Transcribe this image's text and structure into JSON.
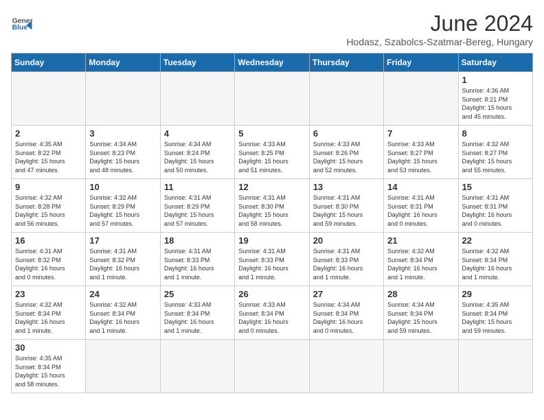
{
  "header": {
    "title": "June 2024",
    "subtitle": "Hodasz, Szabolcs-Szatmar-Bereg, Hungary",
    "logo_general": "General",
    "logo_blue": "Blue"
  },
  "weekdays": [
    "Sunday",
    "Monday",
    "Tuesday",
    "Wednesday",
    "Thursday",
    "Friday",
    "Saturday"
  ],
  "weeks": [
    [
      {
        "day": "",
        "info": ""
      },
      {
        "day": "",
        "info": ""
      },
      {
        "day": "",
        "info": ""
      },
      {
        "day": "",
        "info": ""
      },
      {
        "day": "",
        "info": ""
      },
      {
        "day": "",
        "info": ""
      },
      {
        "day": "1",
        "info": "Sunrise: 4:36 AM\nSunset: 8:21 PM\nDaylight: 15 hours\nand 45 minutes."
      }
    ],
    [
      {
        "day": "2",
        "info": "Sunrise: 4:35 AM\nSunset: 8:22 PM\nDaylight: 15 hours\nand 47 minutes."
      },
      {
        "day": "3",
        "info": "Sunrise: 4:34 AM\nSunset: 8:23 PM\nDaylight: 15 hours\nand 48 minutes."
      },
      {
        "day": "4",
        "info": "Sunrise: 4:34 AM\nSunset: 8:24 PM\nDaylight: 15 hours\nand 50 minutes."
      },
      {
        "day": "5",
        "info": "Sunrise: 4:33 AM\nSunset: 8:25 PM\nDaylight: 15 hours\nand 51 minutes."
      },
      {
        "day": "6",
        "info": "Sunrise: 4:33 AM\nSunset: 8:26 PM\nDaylight: 15 hours\nand 52 minutes."
      },
      {
        "day": "7",
        "info": "Sunrise: 4:33 AM\nSunset: 8:27 PM\nDaylight: 15 hours\nand 53 minutes."
      },
      {
        "day": "8",
        "info": "Sunrise: 4:32 AM\nSunset: 8:27 PM\nDaylight: 15 hours\nand 55 minutes."
      }
    ],
    [
      {
        "day": "9",
        "info": "Sunrise: 4:32 AM\nSunset: 8:28 PM\nDaylight: 15 hours\nand 56 minutes."
      },
      {
        "day": "10",
        "info": "Sunrise: 4:32 AM\nSunset: 8:29 PM\nDaylight: 15 hours\nand 57 minutes."
      },
      {
        "day": "11",
        "info": "Sunrise: 4:31 AM\nSunset: 8:29 PM\nDaylight: 15 hours\nand 57 minutes."
      },
      {
        "day": "12",
        "info": "Sunrise: 4:31 AM\nSunset: 8:30 PM\nDaylight: 15 hours\nand 58 minutes."
      },
      {
        "day": "13",
        "info": "Sunrise: 4:31 AM\nSunset: 8:30 PM\nDaylight: 15 hours\nand 59 minutes."
      },
      {
        "day": "14",
        "info": "Sunrise: 4:31 AM\nSunset: 8:31 PM\nDaylight: 16 hours\nand 0 minutes."
      },
      {
        "day": "15",
        "info": "Sunrise: 4:31 AM\nSunset: 8:31 PM\nDaylight: 16 hours\nand 0 minutes."
      }
    ],
    [
      {
        "day": "16",
        "info": "Sunrise: 4:31 AM\nSunset: 8:32 PM\nDaylight: 16 hours\nand 0 minutes."
      },
      {
        "day": "17",
        "info": "Sunrise: 4:31 AM\nSunset: 8:32 PM\nDaylight: 16 hours\nand 1 minute."
      },
      {
        "day": "18",
        "info": "Sunrise: 4:31 AM\nSunset: 8:33 PM\nDaylight: 16 hours\nand 1 minute."
      },
      {
        "day": "19",
        "info": "Sunrise: 4:31 AM\nSunset: 8:33 PM\nDaylight: 16 hours\nand 1 minute."
      },
      {
        "day": "20",
        "info": "Sunrise: 4:31 AM\nSunset: 8:33 PM\nDaylight: 16 hours\nand 1 minute."
      },
      {
        "day": "21",
        "info": "Sunrise: 4:32 AM\nSunset: 8:34 PM\nDaylight: 16 hours\nand 1 minute."
      },
      {
        "day": "22",
        "info": "Sunrise: 4:32 AM\nSunset: 8:34 PM\nDaylight: 16 hours\nand 1 minute."
      }
    ],
    [
      {
        "day": "23",
        "info": "Sunrise: 4:32 AM\nSunset: 8:34 PM\nDaylight: 16 hours\nand 1 minute."
      },
      {
        "day": "24",
        "info": "Sunrise: 4:32 AM\nSunset: 8:34 PM\nDaylight: 16 hours\nand 1 minute."
      },
      {
        "day": "25",
        "info": "Sunrise: 4:33 AM\nSunset: 8:34 PM\nDaylight: 16 hours\nand 1 minute."
      },
      {
        "day": "26",
        "info": "Sunrise: 4:33 AM\nSunset: 8:34 PM\nDaylight: 16 hours\nand 0 minutes."
      },
      {
        "day": "27",
        "info": "Sunrise: 4:34 AM\nSunset: 8:34 PM\nDaylight: 16 hours\nand 0 minutes."
      },
      {
        "day": "28",
        "info": "Sunrise: 4:34 AM\nSunset: 8:34 PM\nDaylight: 15 hours\nand 59 minutes."
      },
      {
        "day": "29",
        "info": "Sunrise: 4:35 AM\nSunset: 8:34 PM\nDaylight: 15 hours\nand 59 minutes."
      }
    ],
    [
      {
        "day": "30",
        "info": "Sunrise: 4:35 AM\nSunset: 8:34 PM\nDaylight: 15 hours\nand 58 minutes."
      },
      {
        "day": "",
        "info": ""
      },
      {
        "day": "",
        "info": ""
      },
      {
        "day": "",
        "info": ""
      },
      {
        "day": "",
        "info": ""
      },
      {
        "day": "",
        "info": ""
      },
      {
        "day": "",
        "info": ""
      }
    ]
  ]
}
